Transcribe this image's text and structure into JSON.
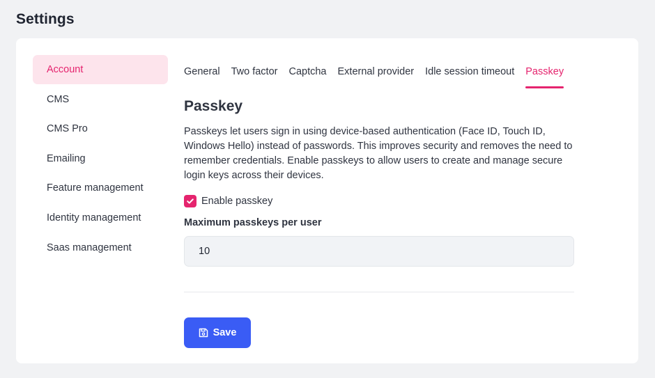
{
  "page": {
    "title": "Settings"
  },
  "sidebar": {
    "items": [
      {
        "label": "Account",
        "active": true
      },
      {
        "label": "CMS"
      },
      {
        "label": "CMS Pro"
      },
      {
        "label": "Emailing"
      },
      {
        "label": "Feature management"
      },
      {
        "label": "Identity management"
      },
      {
        "label": "Saas management"
      }
    ]
  },
  "tabs": [
    {
      "label": "General"
    },
    {
      "label": "Two factor"
    },
    {
      "label": "Captcha"
    },
    {
      "label": "External provider"
    },
    {
      "label": "Idle session timeout"
    },
    {
      "label": "Passkey",
      "active": true
    }
  ],
  "passkey": {
    "title": "Passkey",
    "description": "Passkeys let users sign in using device-based authentication (Face ID, Touch ID, Windows Hello) instead of passwords. This improves security and removes the need to remember credentials. Enable passkeys to allow users to create and manage secure login keys across their devices.",
    "enable_label": "Enable passkey",
    "enabled": true,
    "max_label": "Maximum passkeys per user",
    "max_value": "10",
    "save_label": "Save"
  },
  "colors": {
    "accent": "#e5246e",
    "active_bg": "#fde4ec",
    "primary_button": "#3a5cf5"
  },
  "icons": {
    "checkbox": "check-icon",
    "save": "floppy-disk-icon"
  }
}
